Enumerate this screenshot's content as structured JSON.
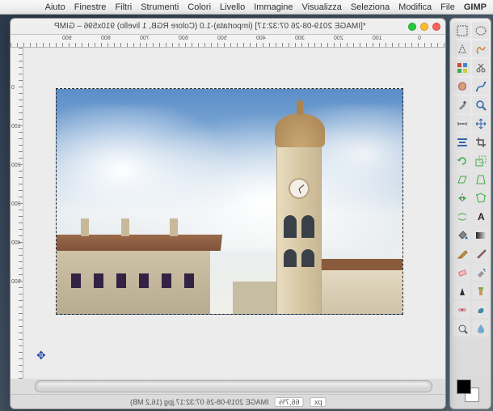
{
  "menubar": {
    "app": "GIMP",
    "items": [
      "File",
      "Modifica",
      "Seleziona",
      "Visualizza",
      "Immagine",
      "Livello",
      "Colori",
      "Strumenti",
      "Filtri",
      "Finestre",
      "Aiuto"
    ]
  },
  "window": {
    "title": "*[IMAGE 2019-08-26 07:32:17] (importata)-1.0 (Colore RGB, 1 livello) 910x596 – GIMP"
  },
  "ruler_h": [
    "0",
    "100",
    "200",
    "300",
    "400",
    "500",
    "600",
    "700",
    "800",
    "900"
  ],
  "ruler_v": [
    "0",
    "100",
    "200",
    "300",
    "400",
    "500"
  ],
  "status": {
    "filename": "IMAGE 2019-08-26 07:32:17.jpg (16,2 MB)",
    "zoom": "66,7%",
    "unit": "px"
  },
  "tools": [
    {
      "n": "rectangle-select-icon"
    },
    {
      "n": "ellipse-select-icon"
    },
    {
      "n": "free-select-icon"
    },
    {
      "n": "fuzzy-select-icon"
    },
    {
      "n": "by-color-select-icon"
    },
    {
      "n": "scissors-icon"
    },
    {
      "n": "foreground-select-icon"
    },
    {
      "n": "paths-icon"
    },
    {
      "n": "color-picker-icon"
    },
    {
      "n": "zoom-icon"
    },
    {
      "n": "measure-icon"
    },
    {
      "n": "move-icon"
    },
    {
      "n": "align-icon"
    },
    {
      "n": "crop-icon"
    },
    {
      "n": "rotate-icon"
    },
    {
      "n": "scale-icon"
    },
    {
      "n": "shear-icon"
    },
    {
      "n": "perspective-icon"
    },
    {
      "n": "flip-icon"
    },
    {
      "n": "cage-icon"
    },
    {
      "n": "warp-icon"
    },
    {
      "n": "text-icon"
    },
    {
      "n": "bucket-fill-icon"
    },
    {
      "n": "blend-icon"
    },
    {
      "n": "pencil-icon"
    },
    {
      "n": "paintbrush-icon"
    },
    {
      "n": "eraser-icon"
    },
    {
      "n": "airbrush-icon"
    },
    {
      "n": "ink-icon"
    },
    {
      "n": "clone-icon"
    },
    {
      "n": "heal-icon"
    },
    {
      "n": "smudge-icon"
    },
    {
      "n": "dodge-icon"
    },
    {
      "n": "blur-icon"
    }
  ]
}
